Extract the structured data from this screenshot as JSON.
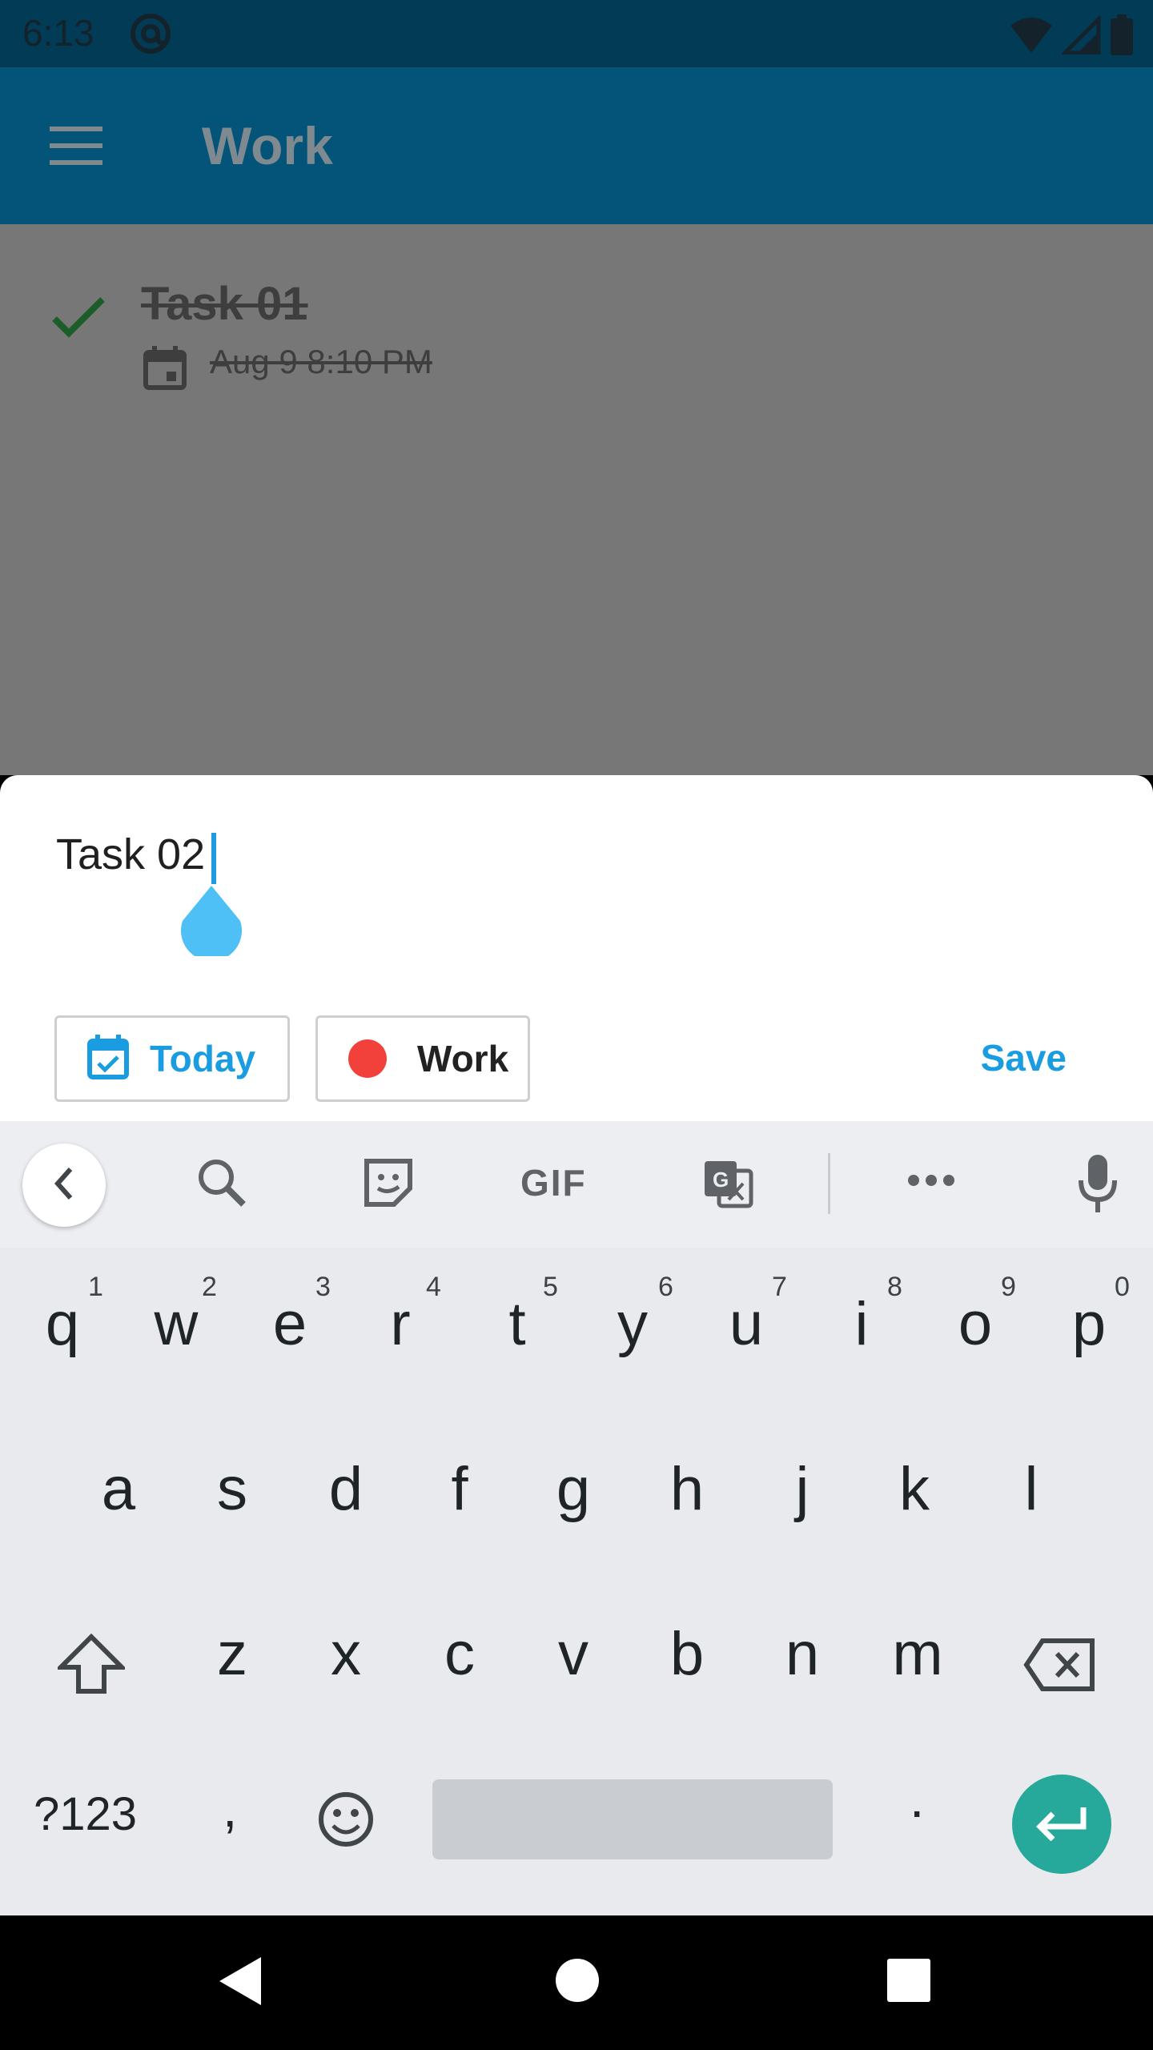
{
  "status_bar": {
    "time": "6:13"
  },
  "app_bar": {
    "title": "Work"
  },
  "tasks": [
    {
      "title": "Task 01",
      "due": "Aug 9 8:10 PM",
      "completed": true
    }
  ],
  "new_task": {
    "input_value": "Task 02",
    "date_chip": "Today",
    "list_chip": "Work",
    "list_color": "#f2413a",
    "save_label": "Save"
  },
  "keyboard": {
    "row1": [
      {
        "key": "q",
        "hint": "1"
      },
      {
        "key": "w",
        "hint": "2"
      },
      {
        "key": "e",
        "hint": "3"
      },
      {
        "key": "r",
        "hint": "4"
      },
      {
        "key": "t",
        "hint": "5"
      },
      {
        "key": "y",
        "hint": "6"
      },
      {
        "key": "u",
        "hint": "7"
      },
      {
        "key": "i",
        "hint": "8"
      },
      {
        "key": "o",
        "hint": "9"
      },
      {
        "key": "p",
        "hint": "0"
      }
    ],
    "row2": [
      "a",
      "s",
      "d",
      "f",
      "g",
      "h",
      "j",
      "k",
      "l"
    ],
    "row3": [
      "z",
      "x",
      "c",
      "v",
      "b",
      "n",
      "m"
    ],
    "symbols_label": "?123",
    "comma": ",",
    "period": ".",
    "gif_label": "GIF"
  },
  "colors": {
    "app_bar": "#045479",
    "status_bar": "#023b56",
    "accent": "#1a9de0",
    "enter": "#26a89a"
  }
}
